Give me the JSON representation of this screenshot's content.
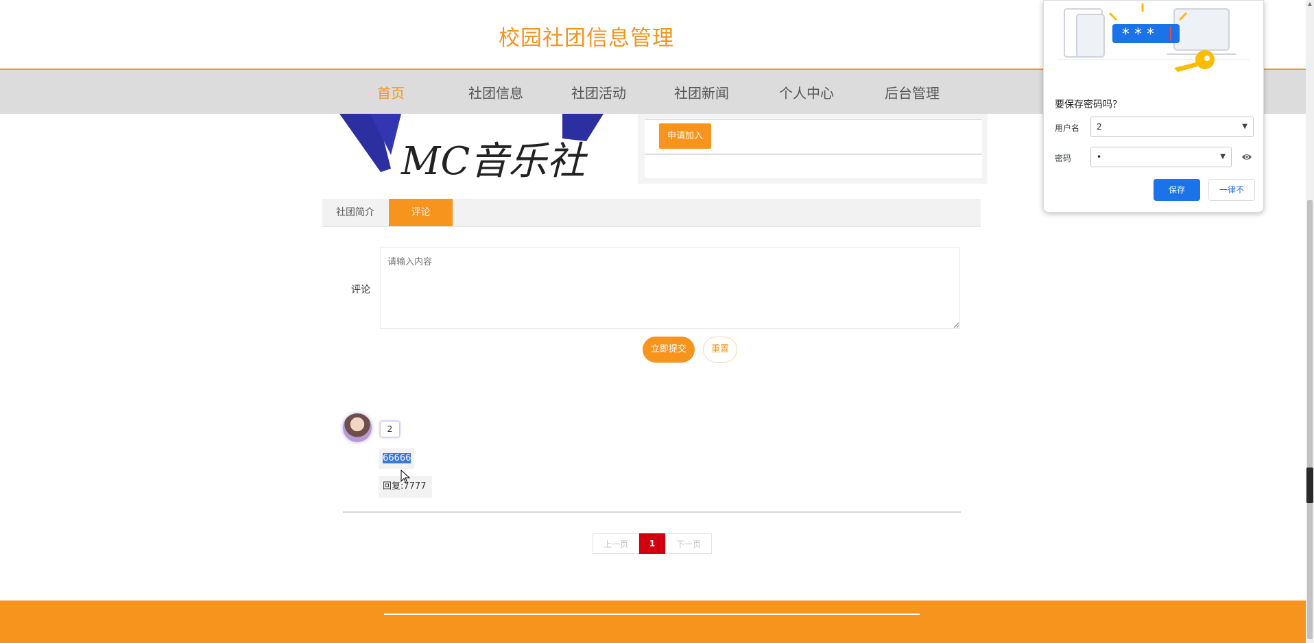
{
  "header": {
    "title": "校园社团信息管理"
  },
  "nav": {
    "items": [
      {
        "label": "首页",
        "active": true
      },
      {
        "label": "社团信息"
      },
      {
        "label": "社团活动"
      },
      {
        "label": "社团新闻"
      },
      {
        "label": "个人中心"
      },
      {
        "label": "后台管理"
      }
    ]
  },
  "club": {
    "logo_text": "MC音乐社",
    "apply_label": "申请加入"
  },
  "tabs": [
    {
      "label": "社团简介"
    },
    {
      "label": "评论",
      "active": true
    }
  ],
  "form": {
    "comment_label": "评论",
    "placeholder": "请输入内容",
    "submit_label": "立即提交",
    "reset_label": "重置"
  },
  "comments": [
    {
      "user": "2",
      "content": "66666",
      "reply": "回复:7777"
    }
  ],
  "pagination": {
    "prev": "上一页",
    "current": "1",
    "next": "下一页"
  },
  "password_popup": {
    "title": "要保存密码吗？",
    "username_label": "用户名",
    "username_value": "2",
    "password_label": "密码",
    "password_value": "•",
    "save_label": "保存",
    "never_label": "一律不",
    "illustration_text": "* * *"
  },
  "colors": {
    "accent": "#f7941d",
    "page_active": "#d0000f",
    "popup_primary": "#1a73e8"
  }
}
